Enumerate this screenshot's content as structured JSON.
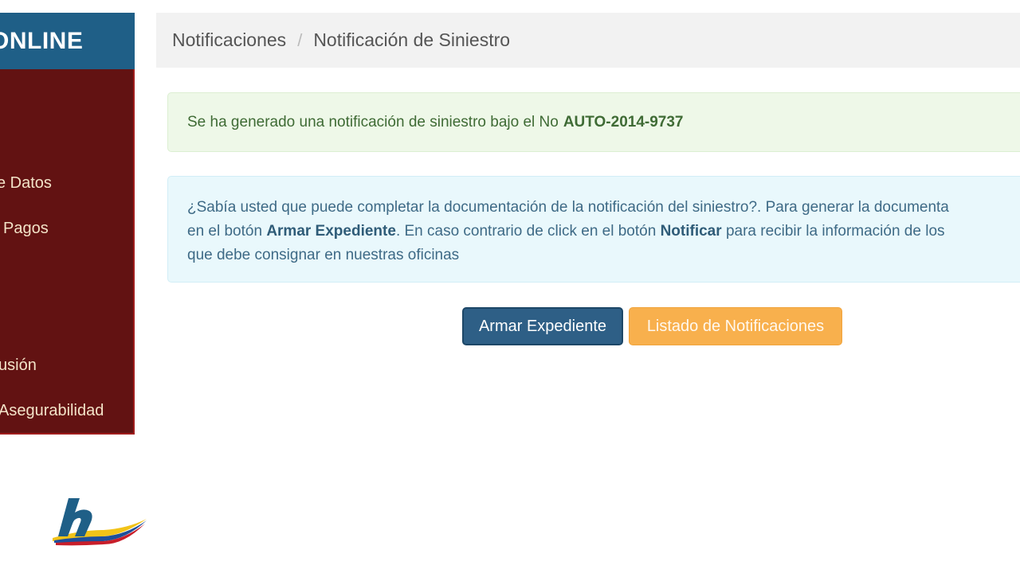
{
  "sidebar": {
    "brand": "ONLINE",
    "items": [
      {
        "label": "e Datos"
      },
      {
        "label": "Pagos"
      },
      {
        "label": "usión"
      },
      {
        "label": "Asegurabilidad"
      }
    ]
  },
  "breadcrumb": {
    "parent": "Notificaciones",
    "separator": "/",
    "current": "Notificación de Siniestro"
  },
  "success_alert": {
    "text": "Se ha generado una notificación de siniestro bajo el No",
    "number": "AUTO-2014-9737"
  },
  "info_alert": {
    "line1": "¿Sabía usted que puede completar la documentación de la notificación del siniestro?. Para generar la documenta",
    "line2_a": "en el botón",
    "line2_b": "Armar Expediente",
    "line2_c": ". En caso contrario de click en el botón",
    "line2_d": "Notificar",
    "line2_e": "para recibir la información de los",
    "line3": "que debe consignar en nuestras oficinas"
  },
  "buttons": {
    "primary": "Armar Expediente",
    "secondary": "Listado de Notificaciones"
  },
  "colors": {
    "sidebar_header": "#1f5f87",
    "sidebar_menu": "#621212",
    "success_bg": "#eef8e8",
    "info_bg": "#e9f8fc",
    "primary_button": "#2e5f86",
    "warning_button": "#f8b04d"
  },
  "icons": {
    "logo": "company-logo-icon"
  }
}
